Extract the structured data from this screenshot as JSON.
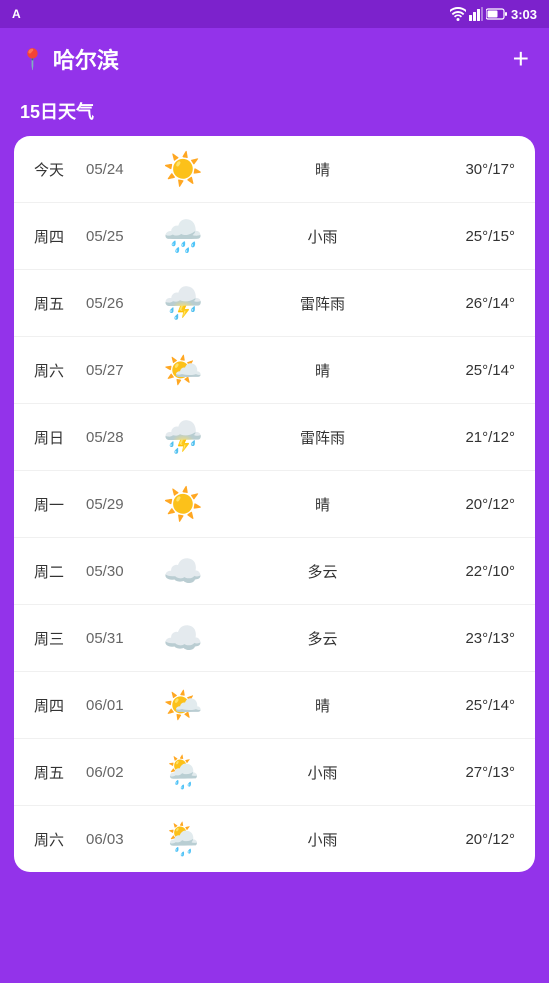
{
  "statusBar": {
    "app": "A",
    "time": "3:03"
  },
  "header": {
    "city": "哈尔滨",
    "addLabel": "+"
  },
  "sectionTitle": "15日天气",
  "weatherRows": [
    {
      "day": "今天",
      "date": "05/24",
      "icon": "☀️",
      "condition": "晴",
      "temp": "30°/17°"
    },
    {
      "day": "周四",
      "date": "05/25",
      "icon": "🌧️",
      "condition": "小雨",
      "temp": "25°/15°"
    },
    {
      "day": "周五",
      "date": "05/26",
      "icon": "⛈️",
      "condition": "雷阵雨",
      "temp": "26°/14°"
    },
    {
      "day": "周六",
      "date": "05/27",
      "icon": "🌤️",
      "condition": "晴",
      "temp": "25°/14°"
    },
    {
      "day": "周日",
      "date": "05/28",
      "icon": "⛈️",
      "condition": "雷阵雨",
      "temp": "21°/12°"
    },
    {
      "day": "周一",
      "date": "05/29",
      "icon": "☀️",
      "condition": "晴",
      "temp": "20°/12°"
    },
    {
      "day": "周二",
      "date": "05/30",
      "icon": "☁️",
      "condition": "多云",
      "temp": "22°/10°"
    },
    {
      "day": "周三",
      "date": "05/31",
      "icon": "☁️",
      "condition": "多云",
      "temp": "23°/13°"
    },
    {
      "day": "周四",
      "date": "06/01",
      "icon": "🌤️",
      "condition": "晴",
      "temp": "25°/14°"
    },
    {
      "day": "周五",
      "date": "06/02",
      "icon": "🌦️",
      "condition": "小雨",
      "temp": "27°/13°"
    },
    {
      "day": "周六",
      "date": "06/03",
      "icon": "🌦️",
      "condition": "小雨",
      "temp": "20°/12°"
    }
  ]
}
